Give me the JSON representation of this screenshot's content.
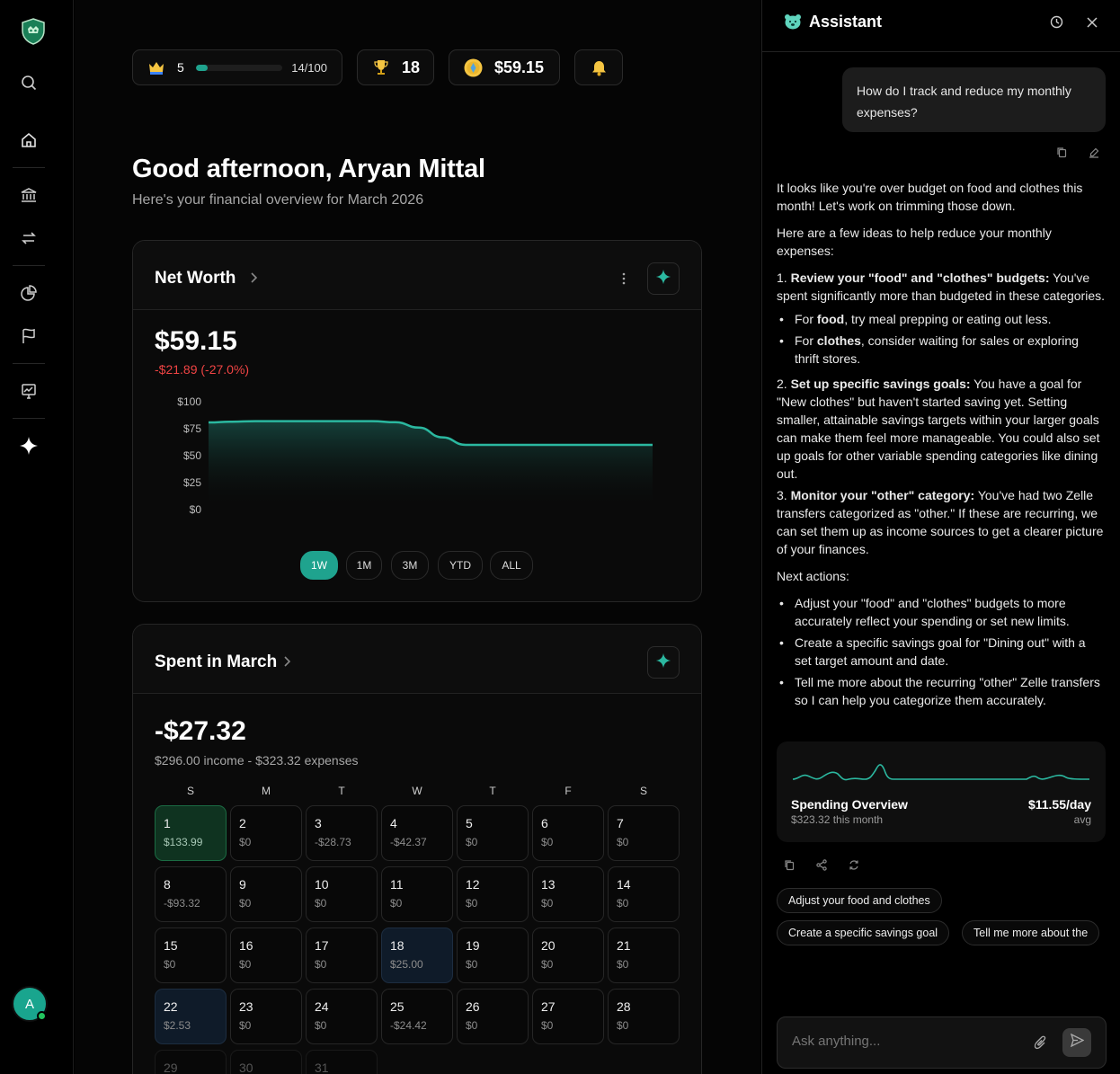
{
  "topbar": {
    "level": "5",
    "xp_progress": 0.14,
    "xp_text": "14/100",
    "trophies": "18",
    "coins": "$59.15"
  },
  "greeting": {
    "title": "Good afternoon, Aryan Mittal",
    "subtitle": "Here's your financial overview for March 2026"
  },
  "net_worth": {
    "title": "Net Worth",
    "value": "$59.15",
    "change": "-$21.89 (-27.0%)",
    "ranges": [
      "1W",
      "1M",
      "3M",
      "YTD",
      "ALL"
    ],
    "active_range": "1W"
  },
  "chart_data": {
    "type": "area",
    "title": "",
    "xlabel": "",
    "ylabel": "",
    "ylim": [
      0,
      100
    ],
    "yticks": [
      "$100",
      "$75",
      "$50",
      "$25",
      "$0"
    ],
    "grid": false,
    "series": [
      {
        "values": [
          80.8,
          81.5,
          82,
          82,
          82,
          82,
          82,
          82,
          81,
          76,
          67,
          60,
          60,
          60,
          60,
          60,
          60,
          60,
          60,
          60
        ]
      }
    ],
    "colors": {
      "line": "#2bb8a0"
    }
  },
  "spent": {
    "title": "Spent in March",
    "value": "-$27.32",
    "summary": "$296.00 income - $323.32 expenses",
    "weekdays": [
      "S",
      "M",
      "T",
      "W",
      "T",
      "F",
      "S"
    ],
    "days": [
      {
        "n": "1",
        "v": "$133.99",
        "style": "green"
      },
      {
        "n": "2",
        "v": "$0"
      },
      {
        "n": "3",
        "v": "-$28.73"
      },
      {
        "n": "4",
        "v": "-$42.37"
      },
      {
        "n": "5",
        "v": "$0"
      },
      {
        "n": "6",
        "v": "$0"
      },
      {
        "n": "7",
        "v": "$0"
      },
      {
        "n": "8",
        "v": "-$93.32"
      },
      {
        "n": "9",
        "v": "$0"
      },
      {
        "n": "10",
        "v": "$0"
      },
      {
        "n": "11",
        "v": "$0"
      },
      {
        "n": "12",
        "v": "$0"
      },
      {
        "n": "13",
        "v": "$0"
      },
      {
        "n": "14",
        "v": "$0"
      },
      {
        "n": "15",
        "v": "$0"
      },
      {
        "n": "16",
        "v": "$0"
      },
      {
        "n": "17",
        "v": "$0"
      },
      {
        "n": "18",
        "v": "$25.00",
        "style": "blue"
      },
      {
        "n": "19",
        "v": "$0"
      },
      {
        "n": "20",
        "v": "$0"
      },
      {
        "n": "21",
        "v": "$0"
      },
      {
        "n": "22",
        "v": "$2.53",
        "style": "blue"
      },
      {
        "n": "23",
        "v": "$0"
      },
      {
        "n": "24",
        "v": "$0"
      },
      {
        "n": "25",
        "v": "-$24.42"
      },
      {
        "n": "26",
        "v": "$0"
      },
      {
        "n": "27",
        "v": "$0"
      },
      {
        "n": "28",
        "v": "$0"
      },
      {
        "n": "29",
        "v": "",
        "style": "faded"
      },
      {
        "n": "30",
        "v": "",
        "style": "faded"
      },
      {
        "n": "31",
        "v": "",
        "style": "faded"
      }
    ]
  },
  "assistant": {
    "title": "Assistant",
    "user_message": "How do I track and reduce my monthly expenses?",
    "p1": "It looks like you're over budget on food and clothes this month! Let's work on trimming those down.",
    "p2": "Here are a few ideas to help reduce your monthly expenses:",
    "i1_num": "1.",
    "i1_bold": "Review your \"food\" and \"clothes\" budgets:",
    "i1_text": " You've spent significantly more than budgeted in these categories.",
    "b1_pre": "For ",
    "b1_bold": "food",
    "b1_text": ", try meal prepping or eating out less.",
    "b2_pre": "For ",
    "b2_bold": "clothes",
    "b2_text": ", consider waiting for sales or exploring thrift stores.",
    "i2_num": "2.",
    "i2_bold": "Set up specific savings goals:",
    "i2_text": " You have a goal for \"New clothes\" but haven't started saving yet. Setting smaller, attainable savings targets within your larger goals can make them feel more manageable. You could also set up goals for other variable spending categories like dining out.",
    "i3_num": "3.",
    "i3_bold": "Monitor your \"other\" category:",
    "i3_text": " You've had two Zelle transfers categorized as \"other.\" If these are recurring, we can set them up as income sources to get a clearer picture of your finances.",
    "next_label": "Next actions:",
    "next_actions": [
      "Adjust your \"food\" and \"clothes\" budgets to more accurately reflect your spending or set new limits.",
      "Create a specific savings goal for \"Dining out\" with a set target amount and date.",
      "Tell me more about the recurring \"other\" Zelle transfers so I can help you categorize them accurately."
    ],
    "spending": {
      "title": "Spending Overview",
      "sub": "$323.32 this month",
      "rate": "$11.55/day",
      "rate_sub": "avg"
    },
    "suggestions": [
      "Adjust your food and clothes",
      "Create a specific savings goal",
      "Tell me more about the"
    ],
    "input_placeholder": "Ask anything..."
  },
  "colors": {
    "accent": "#1fa38e",
    "negative": "#ef4444",
    "positive_day": "#0f3320"
  }
}
